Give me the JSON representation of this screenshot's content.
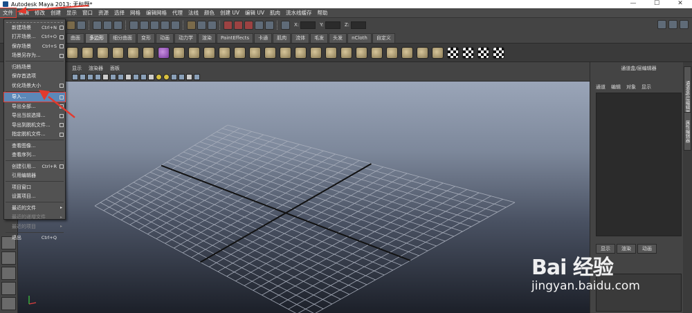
{
  "window": {
    "title": "Autodesk Maya 2013: 无标题*",
    "minimize_glyph": "—",
    "maximize_glyph": "☐",
    "close_glyph": "✕"
  },
  "menubar": {
    "items": [
      "文件",
      "编辑",
      "修改",
      "创建",
      "显示",
      "窗口",
      "资源",
      "选择",
      "网格",
      "编辑网格",
      "代理",
      "法线",
      "颜色",
      "创建 UV",
      "编辑 UV",
      "肌肉",
      "流水线缓存",
      "帮助"
    ]
  },
  "statusline": {
    "x_label": "X:",
    "y_label": "Y:",
    "z_label": "Z:"
  },
  "shelf_tabs": [
    "曲面",
    "多边形",
    "细分曲面",
    "变形",
    "动画",
    "动力学",
    "渲染",
    "PaintEffects",
    "卡通",
    "肌肉",
    "流体",
    "毛发",
    "头发",
    "nCloth",
    "自定义"
  ],
  "shelf_active_tab": "多边形",
  "viewport": {
    "menus": [
      "显示",
      "渲染器",
      "面板"
    ]
  },
  "right_panel": {
    "title": "通道盒/层编辑器",
    "menus": [
      "通道",
      "编辑",
      "对象",
      "显示"
    ],
    "side_tabs": [
      "通道盒/层编辑器",
      "属性编辑器"
    ],
    "layer_tabs": [
      "显示",
      "渲染",
      "动画"
    ]
  },
  "file_menu": {
    "items": [
      {
        "label": "新建场景",
        "shortcut": "Ctrl+N",
        "option": true
      },
      {
        "label": "打开场景...",
        "shortcut": "Ctrl+O",
        "option": true
      },
      {
        "label": "保存场景",
        "shortcut": "Ctrl+S",
        "option": true
      },
      {
        "label": "场景另存为...",
        "shortcut": "",
        "option": true
      },
      {
        "label": "归档场景",
        "shortcut": "",
        "option": false
      },
      {
        "label": "保存首选项",
        "shortcut": "",
        "option": false
      },
      {
        "label": "优化场景大小",
        "shortcut": "",
        "option": true
      },
      {
        "label": "导入...",
        "shortcut": "",
        "option": true,
        "highlight": true
      },
      {
        "label": "导出全部...",
        "shortcut": "",
        "option": true
      },
      {
        "label": "导出当前选择...",
        "shortcut": "",
        "option": true
      },
      {
        "label": "导出到脱机文件...",
        "shortcut": "",
        "option": true
      },
      {
        "label": "指定脱机文件...",
        "shortcut": "",
        "option": true
      },
      {
        "label": "查看图像...",
        "shortcut": "",
        "option": false
      },
      {
        "label": "查看序列...",
        "shortcut": "",
        "option": false
      },
      {
        "label": "创建引用...",
        "shortcut": "Ctrl+R",
        "option": true
      },
      {
        "label": "引用编辑器",
        "shortcut": "",
        "option": false
      },
      {
        "label": "项目窗口",
        "shortcut": "",
        "option": false
      },
      {
        "label": "设置项目...",
        "shortcut": "",
        "option": false
      },
      {
        "label": "最近的文件",
        "shortcut": "",
        "submenu": true
      },
      {
        "label": "最近的递增文件",
        "shortcut": "",
        "submenu": true,
        "disabled": true
      },
      {
        "label": "最近的项目",
        "shortcut": "",
        "submenu": true,
        "disabled": true
      },
      {
        "label": "退出",
        "shortcut": "Ctrl+Q",
        "option": false
      }
    ]
  },
  "watermark": {
    "logo": "Bai 经验",
    "url": "jingyan.baidu.com"
  },
  "colors": {
    "highlight": "#5c88b8",
    "annotation": "#e23a2e"
  }
}
